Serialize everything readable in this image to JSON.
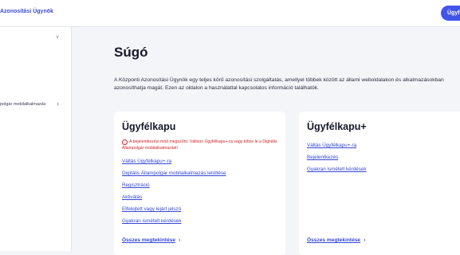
{
  "header": {
    "brand": "Azonosítási Ügynök",
    "login_button": "Ügyf"
  },
  "sidebar": {
    "item_label": "polgár mobilalkalmazás"
  },
  "main": {
    "title": "Súgó",
    "intro": "A Központi Azonosítási Ügynök egy teljes körű azonosítási szolgáltatás, amellyel többek között az állami weboldalakon és alkalmazásokban azonosíthatja magát. Ezen az oldalon a használattal kapcsolatos információ találhatók."
  },
  "cards": [
    {
      "title": "Ügyfélkapu",
      "warning": "A bejelentkezési mód megszűnt. Váltson Ügyfélkapu+-ra vagy töltse le a Digitális Állampolgár mobilalkalmazást!",
      "links": [
        "Váltás Ügyfélkapu+-ra",
        "Digitális Állampolgár mobilalkalmazás letöltése",
        "Regisztráció",
        "Aktiválás",
        "Elfelejtett vagy lejárt jelszó",
        "Gyakran ismételt kérdések"
      ],
      "all_link": "Összes megtekintése"
    },
    {
      "title": "Ügyfélkapu+",
      "links": [
        "Váltás Ügyfélkapu+-ra",
        "Bejelentkezés",
        "Gyakran ismételt kérdések"
      ],
      "all_link": "Összes megtekintése"
    }
  ],
  "icons": {
    "chevron_down": "˅",
    "chevron_right": "›",
    "warning": "!"
  },
  "colors": {
    "accent": "#4254e8",
    "link": "#3347d4",
    "warning": "#d2232a",
    "background": "#f4f5f8"
  }
}
